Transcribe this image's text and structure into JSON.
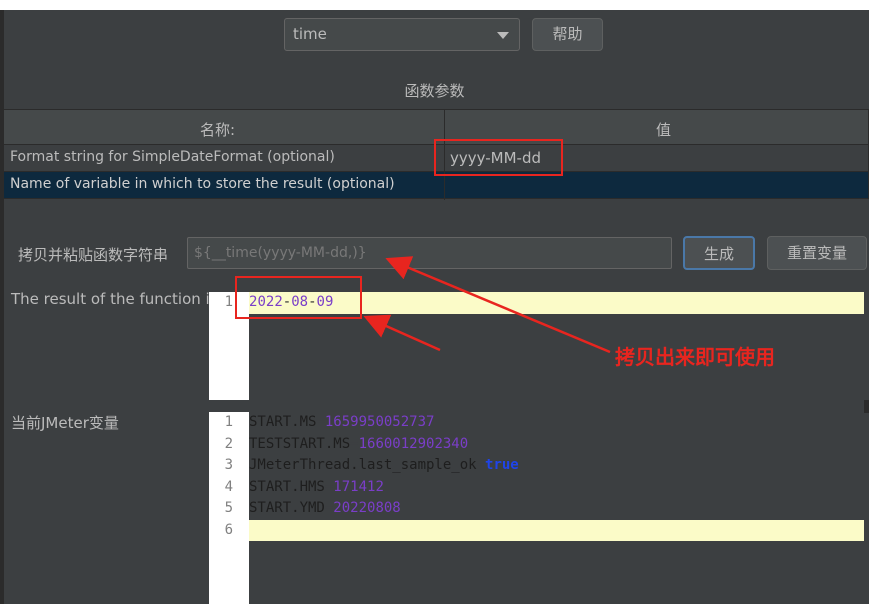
{
  "function_select": {
    "value": "time"
  },
  "help_button": "帮助",
  "params_title": "函数参数",
  "table": {
    "headers": [
      "名称:",
      "值"
    ],
    "rows": [
      {
        "name": "Format string for SimpleDateFormat (optional)",
        "value": "yyyy-MM-dd"
      },
      {
        "name": "Name of variable in which to store the result (optional)",
        "value": ""
      }
    ]
  },
  "copy_label": "拷贝并粘贴函数字符串",
  "function_string": "${__time(yyyy-MM-dd,)}",
  "generate_button": "生成",
  "reset_button": "重置变量",
  "result_label": "The result of the function is",
  "result_lines": [
    "2022-08-09"
  ],
  "vars_label": "当前JMeter变量",
  "vars_lines": [
    {
      "key": "START.MS",
      "sep": "=",
      "value": "1659950052737"
    },
    {
      "key": "TESTSTART.MS",
      "sep": "=",
      "value": "1660012902340"
    },
    {
      "key": "JMeterThread.last_sample_ok",
      "sep": "=",
      "value": "true"
    },
    {
      "key": "START.HMS",
      "sep": "=",
      "value": "171412"
    },
    {
      "key": "START.YMD",
      "sep": "=",
      "value": "20220808"
    },
    {
      "key": "",
      "sep": "",
      "value": ""
    }
  ],
  "line_numbers": [
    "1",
    "2",
    "3",
    "4",
    "5",
    "6"
  ],
  "annotation": "拷贝出来即可使用",
  "colors": {
    "accent_red": "#e8251f",
    "number_purple": "#7a3ec8",
    "keyword_blue": "#1f44e8",
    "highlight_yellow": "#fbfbc8",
    "selected_row": "#0d293e"
  }
}
